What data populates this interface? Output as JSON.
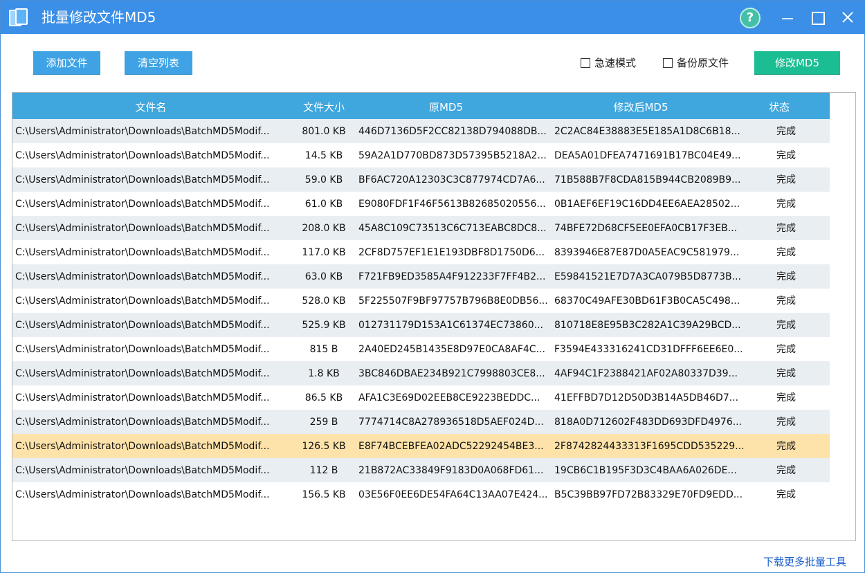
{
  "window": {
    "title": "批量修改文件MD5",
    "help_label": "?"
  },
  "toolbar": {
    "add_label": "添加文件",
    "clear_label": "清空列表",
    "fast_mode_label": "急速模式",
    "backup_label": "备份原文件",
    "modify_label": "修改MD5",
    "fast_mode_checked": false,
    "backup_checked": false
  },
  "table": {
    "headers": {
      "name": "文件名",
      "size": "文件大小",
      "orig": "原MD5",
      "new": "修改后MD5",
      "status": "状态"
    },
    "rows": [
      {
        "name": "C:\\Users\\Administrator\\Downloads\\BatchMD5Modif...",
        "size": "801.0 KB",
        "orig": "446D7136D5F2CC82138D794088DB...",
        "new": "2C2AC84E38883E5E185A1D8C6B18...",
        "status": "完成"
      },
      {
        "name": "C:\\Users\\Administrator\\Downloads\\BatchMD5Modif...",
        "size": "14.5 KB",
        "orig": "59A2A1D770BD873D57395B5218A2...",
        "new": "DEA5A01DFEA7471691B17BC04E49...",
        "status": "完成"
      },
      {
        "name": "C:\\Users\\Administrator\\Downloads\\BatchMD5Modif...",
        "size": "59.0 KB",
        "orig": "BF6AC720A12303C3C877974CD7A6...",
        "new": "71B588B7F8CDA815B944CB2089B9...",
        "status": "完成"
      },
      {
        "name": "C:\\Users\\Administrator\\Downloads\\BatchMD5Modif...",
        "size": "61.0 KB",
        "orig": "E9080FDF1F46F5613B82685020556...",
        "new": "0B1AEF6EF19C16DD4EE6AEA28502...",
        "status": "完成"
      },
      {
        "name": "C:\\Users\\Administrator\\Downloads\\BatchMD5Modif...",
        "size": "208.0 KB",
        "orig": "45A8C109C73513C6C713EABC8DC8...",
        "new": "74BFE72D68CF5EE0EFA0CB17F3EB...",
        "status": "完成"
      },
      {
        "name": "C:\\Users\\Administrator\\Downloads\\BatchMD5Modif...",
        "size": "117.0 KB",
        "orig": "2CF8D757EF1E1E193DBF8D1750D6...",
        "new": "8393946E87E87D0A5EAC9C581979...",
        "status": "完成"
      },
      {
        "name": "C:\\Users\\Administrator\\Downloads\\BatchMD5Modif...",
        "size": "63.0 KB",
        "orig": "F721FB9ED3585A4F912233F7FF4B2...",
        "new": "E59841521E7D7A3CA079B5D8773B...",
        "status": "完成"
      },
      {
        "name": "C:\\Users\\Administrator\\Downloads\\BatchMD5Modif...",
        "size": "528.0 KB",
        "orig": "5F225507F9BF97757B796B8E0DB56...",
        "new": "68370C49AFE30BD61F3B0CA5C498...",
        "status": "完成"
      },
      {
        "name": "C:\\Users\\Administrator\\Downloads\\BatchMD5Modif...",
        "size": "525.9 KB",
        "orig": "012731179D153A1C61374EC73860...",
        "new": "810718E8E95B3C282A1C39A29BCD...",
        "status": "完成"
      },
      {
        "name": "C:\\Users\\Administrator\\Downloads\\BatchMD5Modif...",
        "size": "815 B",
        "orig": "2A40ED245B1435E8D97E0CA8AF4C...",
        "new": "F3594E433316241CD31DFFF6EE6E0...",
        "status": "完成"
      },
      {
        "name": "C:\\Users\\Administrator\\Downloads\\BatchMD5Modif...",
        "size": "1.8 KB",
        "orig": "3BC846DBAE234B921C7998803CE8...",
        "new": "4AF94C1F2388421AF02A80337D39...",
        "status": "完成"
      },
      {
        "name": "C:\\Users\\Administrator\\Downloads\\BatchMD5Modif...",
        "size": "86.5 KB",
        "orig": "AFA1C3E69D02EEB8CE9223BEDDC...",
        "new": "41EFFBD7D12D50D3B14A5DB46D7...",
        "status": "完成"
      },
      {
        "name": "C:\\Users\\Administrator\\Downloads\\BatchMD5Modif...",
        "size": "259 B",
        "orig": "7774714C8A278936518D5AEF024D...",
        "new": "818A0D712602F483DD693DFD4976...",
        "status": "完成"
      },
      {
        "name": "C:\\Users\\Administrator\\Downloads\\BatchMD5Modif...",
        "size": "126.5 KB",
        "orig": "E8F74BCEBFEA02ADC52292454BE3...",
        "new": "2F8742824433313F1695CDD535229...",
        "status": "完成"
      },
      {
        "name": "C:\\Users\\Administrator\\Downloads\\BatchMD5Modif...",
        "size": "112 B",
        "orig": "21B872AC33849F9183D0A068FD61...",
        "new": "19CB6C1B195F3D3C4BAA6A026DE...",
        "status": "完成"
      },
      {
        "name": "C:\\Users\\Administrator\\Downloads\\BatchMD5Modif...",
        "size": "156.5 KB",
        "orig": "03E56F0EE6DE54FA64C13AA07E424...",
        "new": "B5C39BB97FD72B83329E70FD9EDD...",
        "status": "完成"
      }
    ],
    "selected_row_index": 13
  },
  "footer": {
    "link_label": "下载更多批量工具"
  },
  "colors": {
    "titlebar": "#3b8fe6",
    "header": "#3fa6de",
    "button_blue": "#3ea2e4",
    "button_green": "#1bbd92",
    "row_alt": "#e9eef3",
    "row_selected": "#fde2a9",
    "link": "#1a5fcc"
  },
  "icons": {
    "app": "app-icon",
    "help": "help-icon",
    "minimize": "minimize-icon",
    "maximize": "maximize-icon",
    "close": "close-icon"
  }
}
